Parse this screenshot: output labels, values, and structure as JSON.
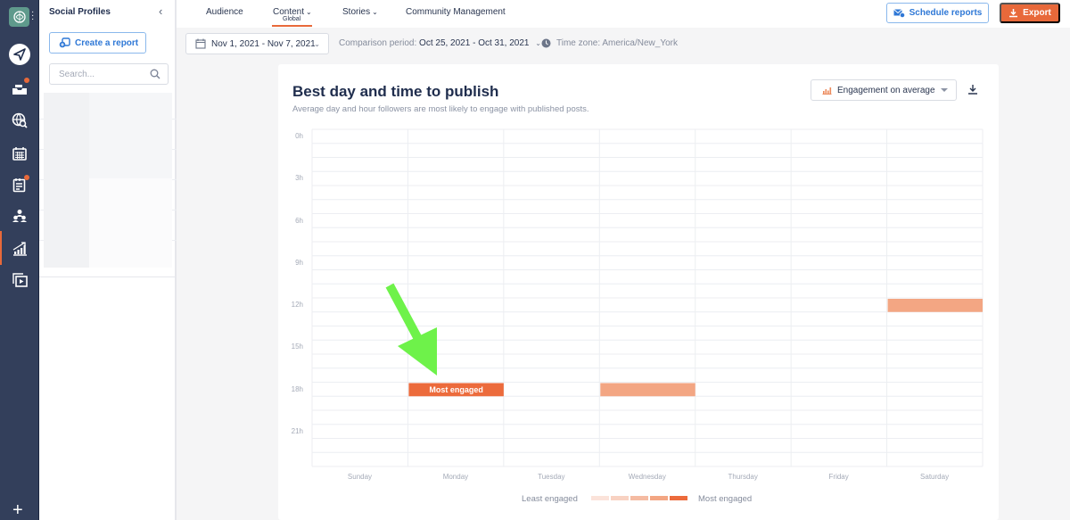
{
  "rail": {
    "items": [
      {
        "name": "publish",
        "icon": "paper-plane-icon"
      },
      {
        "name": "inbox",
        "icon": "inbox-icon",
        "has_badge": true
      },
      {
        "name": "listening",
        "icon": "globe-search-icon"
      },
      {
        "name": "calendar",
        "icon": "calendar-icon"
      },
      {
        "name": "tasks",
        "icon": "clipboard-icon",
        "has_badge": true
      },
      {
        "name": "audience",
        "icon": "people-icon"
      },
      {
        "name": "analytics",
        "icon": "bar-chart-icon",
        "active": true
      },
      {
        "name": "media",
        "icon": "media-library-icon"
      }
    ],
    "add_label": "+"
  },
  "panel": {
    "title": "Social Profiles",
    "collapse_icon": "chevron-left-icon",
    "create_report_label": "Create a report",
    "search_placeholder": "Search..."
  },
  "topnav": {
    "tabs": [
      {
        "label": "Audience",
        "has_dropdown": false
      },
      {
        "label": "Content",
        "has_dropdown": true,
        "sub": "Global",
        "active": true
      },
      {
        "label": "Stories",
        "has_dropdown": true
      },
      {
        "label": "Community Management",
        "has_dropdown": false
      }
    ],
    "schedule_reports_label": "Schedule reports",
    "export_label": "Export"
  },
  "filters": {
    "date_range": "Nov 1, 2021 - Nov 7, 2021",
    "comparison_label": "Comparison period:",
    "comparison_value": "Oct 25, 2021 - Oct 31, 2021",
    "timezone": "Time zone: America/New_York"
  },
  "card": {
    "title": "Best day and time to publish",
    "subtitle": "Average day and hour followers are most likely to engage with published posts.",
    "metric_selector": "Engagement on average",
    "annotation_arrow_color": "#6ef24a"
  },
  "chart_data": {
    "type": "heatmap",
    "title": "Best day and time to publish",
    "x": [
      "Sunday",
      "Monday",
      "Tuesday",
      "Wednesday",
      "Thursday",
      "Friday",
      "Saturday"
    ],
    "y_hours": [
      0,
      1,
      2,
      3,
      4,
      5,
      6,
      7,
      8,
      9,
      10,
      11,
      12,
      13,
      14,
      15,
      16,
      17,
      18,
      19,
      20,
      21,
      22,
      23
    ],
    "y_tick_labels": [
      "0h",
      "3h",
      "6h",
      "9h",
      "12h",
      "15h",
      "18h",
      "21h"
    ],
    "highlighted_cells": [
      {
        "day": "Monday",
        "hour": 18,
        "level": 5,
        "label": "Most engaged"
      },
      {
        "day": "Wednesday",
        "hour": 18,
        "level": 4,
        "label": ""
      },
      {
        "day": "Saturday",
        "hour": 12,
        "level": 4,
        "label": ""
      }
    ],
    "scale_levels": 5,
    "scale_colors": [
      "#fbe3da",
      "#f8d2c2",
      "#f5bba2",
      "#f3a683",
      "#ec6b3c"
    ],
    "legend": {
      "min_label": "Least engaged",
      "max_label": "Most engaged",
      "placement": "bottom-center"
    },
    "grid": true
  }
}
